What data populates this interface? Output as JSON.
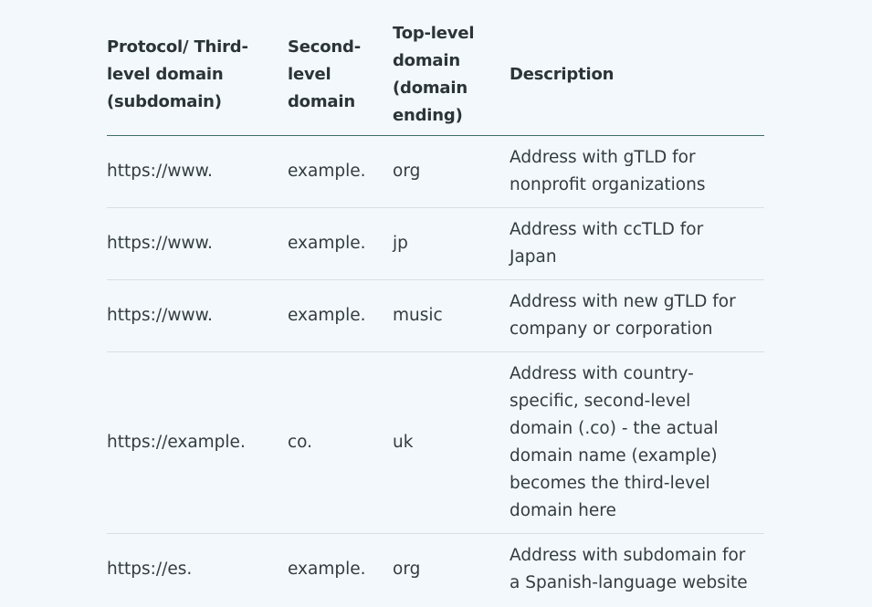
{
  "table": {
    "headers": [
      "Protocol/ Third-level domain (subdomain)",
      "Second-level domain",
      "Top-level domain (domain ending)",
      "Description"
    ],
    "rows": [
      {
        "subdomain": "https://www.",
        "second_level": "example.",
        "top_level": "org",
        "description": "Address with gTLD for nonprofit organizations"
      },
      {
        "subdomain": "https://www.",
        "second_level": "example.",
        "top_level": "jp",
        "description": "Address with ccTLD for Japan"
      },
      {
        "subdomain": "https://www.",
        "second_level": "example.",
        "top_level": "music",
        "description": "Address with new gTLD for company or corporation"
      },
      {
        "subdomain": "https://example.",
        "second_level": "co.",
        "top_level": "uk",
        "description": "Address with country-specific, second-level domain (.co) - the actual domain name (example) becomes the third-level domain here"
      },
      {
        "subdomain": "https://es.",
        "second_level": "example.",
        "top_level": "org",
        "description": "Address with subdomain for a Spanish-language website"
      }
    ]
  }
}
